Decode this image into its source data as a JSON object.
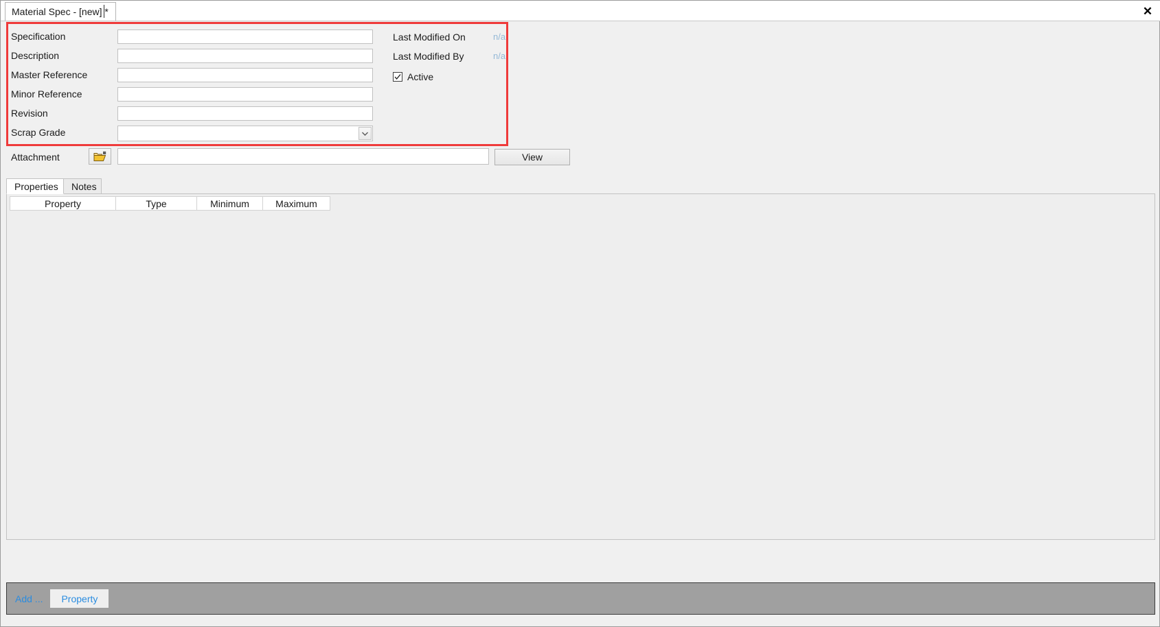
{
  "window": {
    "tab_title": "Material Spec - [new] *",
    "close_label": "✕"
  },
  "header_form": {
    "fields": [
      {
        "label": "Specification",
        "value": "",
        "type": "text"
      },
      {
        "label": "Description",
        "value": "",
        "type": "text"
      },
      {
        "label": "Master Reference",
        "value": "",
        "type": "text"
      },
      {
        "label": "Minor Reference",
        "value": "",
        "type": "text"
      },
      {
        "label": "Revision",
        "value": "",
        "type": "text"
      },
      {
        "label": "Scrap Grade",
        "value": "",
        "type": "select"
      }
    ],
    "meta": [
      {
        "label": "Last Modified On",
        "value": "n/a"
      },
      {
        "label": "Last Modified By",
        "value": "n/a"
      }
    ],
    "active": {
      "label": "Active",
      "checked": true
    }
  },
  "attachment": {
    "label": "Attachment",
    "browse_icon": "open-folder-icon",
    "value": "",
    "view_label": "View"
  },
  "tabs": [
    {
      "label": "Properties",
      "active": true
    },
    {
      "label": "Notes",
      "active": false
    }
  ],
  "grid": {
    "columns": [
      "Property",
      "Type",
      "Minimum",
      "Maximum"
    ],
    "rows": []
  },
  "action_bar": {
    "add_label": "Add ...",
    "property_label": "Property"
  },
  "colors": {
    "highlight": "#ef3a3a",
    "link": "#2a8ce0",
    "meta_value": "#94b8d6",
    "action_bar_bg": "#a0a0a0",
    "panel_bg": "#eeeeee",
    "window_bg": "#f0f0f0"
  }
}
